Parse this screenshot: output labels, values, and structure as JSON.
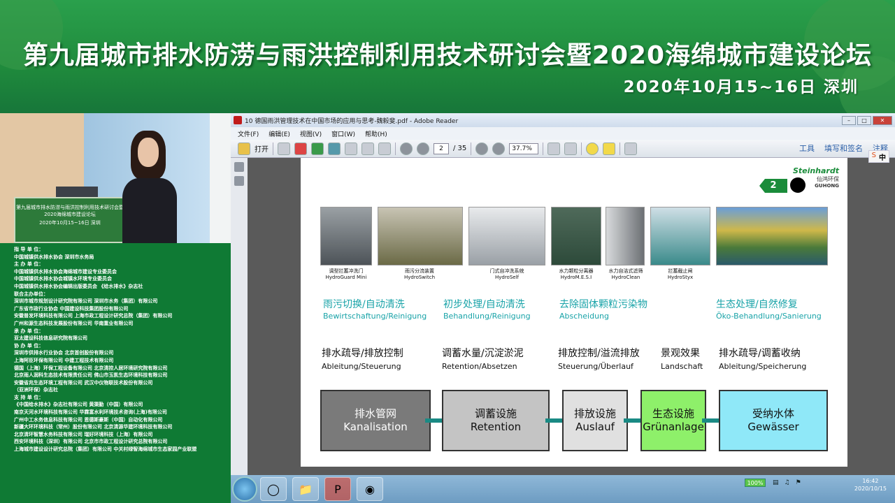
{
  "banner": {
    "title": "第九届城市排水防涝与雨洪控制利用技术研讨会暨2020海绵城市建设论坛",
    "date_location": "2020年10月15~16日   深圳"
  },
  "video": {
    "podium_text": "第九届城市排水防涝与雨洪控制利用技术研讨会暨2020海绵城市建设论坛",
    "podium_date": "2020年10月15~16日 深圳"
  },
  "sponsors": [
    "指 导 单 位：",
    "中国城镇供水排水协会  深圳市水务局",
    "主 办 单 位：",
    "中国城镇供水排水协会海绵城市建设专业委员会",
    "中国城镇供水排水协会城镇水环境专业委员会",
    "中国城镇供水排水协会编辑出版委员会 《给水排水》杂志社",
    "联合主办单位：",
    "深圳市城市规划设计研究院有限公司  深圳市水务（集团）有限公司",
    "广东省市政行业协会  中国建设科技集团股份有限公司",
    "安徽普发环境科技有限公司  上海市政工程设计研究总院（集团）有限公司",
    "广州和源生态科技发展股份有限公司  华南重业有限公司",
    "承 办 单 位：",
    "亚太建设科技信息研究院有限公司",
    "协 办 单 位：",
    "深圳市供排水行业协会  北京首创股份有限公司",
    "上海阿臣环保有限公司  中建工程技术有限公司",
    "德国（上海）环保工程设备有限公司  北京清控人居环境研究院有限公司",
    "北京雨人润科生态技术有限责任公司  佛山市玉凯生态环境科技有限公司",
    "安徽省兆生态环境工程有限公司  武汉中仪物联技术股份有限公司",
    "（亚洲环保）杂志社",
    "支 持 单 位：",
    "《中国给水排水》杂志社有限公司  黄渠勤（中国）有限公司",
    "南京天河水环境科技有限公司  华霖富水利环境技术咨询(上海)有限公司",
    "广州中工水务信息科技有限公司  恩德斯豪斯（中国）自动化有限公司",
    "新疆大环环境科技（常州）股份有限公司  北京清源华建环境科技有限公司",
    "北京清环智慧水务科技有限公司  瑞好环境科技（上海）有限公司",
    "西安环境科技（深圳）有限公司  北京市市政工程设计研究总院有限公司",
    "上海城市建设设计研究总院（集团）有限公司  中关村绿智海绵城市生态家园产业联盟"
  ],
  "reader": {
    "window_title": "10 德国雨洪管理技术在中国市场的应用与思考-魏毅斐.pdf - Adobe Reader",
    "menu": [
      "文件(F)",
      "编辑(E)",
      "视图(V)",
      "窗口(W)",
      "帮助(H)"
    ],
    "open_label": "打开",
    "page_current": "2",
    "page_total": "/ 35",
    "zoom_value": "37.7%",
    "right_tools": [
      "工具",
      "填写和签名",
      "注释"
    ],
    "ime_label": "中",
    "ime_logo": "S"
  },
  "slide": {
    "logo": {
      "brand": "Steinhardt",
      "cn": "仙鸿环保",
      "sub": "GUHONG"
    },
    "page_number": "2",
    "photos": [
      {
        "cap_cn": "调型拦蓄冲洗门",
        "cap_en": "HydroGuard Mini"
      },
      {
        "cap_cn": "雨污分流装置",
        "cap_en": "HydroSwitch"
      },
      {
        "cap_cn": "门式自冲洗系统",
        "cap_en": "HydroSelf"
      },
      {
        "cap_cn": "水力颗粒分离器",
        "cap_en": "HydroM.E.S.I"
      },
      {
        "cap_cn": "水力自洁式滤筛",
        "cap_en": "HydroClean"
      },
      {
        "cap_cn": "拦蓄截止闸",
        "cap_en": "HydroStyx"
      }
    ],
    "categories": [
      {
        "cn": "雨污切换/自动清洗",
        "de": "Bewirtschaftung/Reinigung"
      },
      {
        "cn": "初步处理/自动清洗",
        "de": "Behandlung/Reinigung"
      },
      {
        "cn": "去除固体颗粒污染物",
        "de": "Abscheidung"
      },
      {
        "cn": "生态处理/自然修复",
        "de": "Öko-Behandlung/Sanierung"
      }
    ],
    "functions": [
      {
        "cn": "排水疏导/排放控制",
        "de": "Ableitung/Steuerung"
      },
      {
        "cn": "调蓄水量/沉淀淤泥",
        "de": "Retention/Absetzen"
      },
      {
        "cn": "排放控制/溢流排放",
        "de": "Steuerung/Überlauf"
      },
      {
        "cn": "景观效果",
        "de": "Landschaft"
      },
      {
        "cn": "排水疏导/调蓄收纳",
        "de": "Ableitung/Speicherung"
      }
    ],
    "flow": [
      {
        "cn": "排水管网",
        "de": "Kanalisation",
        "color": "#7a7a7a"
      },
      {
        "cn": "调蓄设施",
        "de": "Retention",
        "color": "#c4c4c4"
      },
      {
        "cn": "排放设施",
        "de": "Auslauf",
        "color": "#e0e0e0"
      },
      {
        "cn": "生态设施",
        "de": "Grünanlage",
        "color": "#8ef06a"
      },
      {
        "cn": "受纳水体",
        "de": "Gewässer",
        "color": "#8fe8f8"
      }
    ]
  },
  "taskbar": {
    "battery": "100%",
    "time": "16:42",
    "date": "2020/10/15"
  }
}
